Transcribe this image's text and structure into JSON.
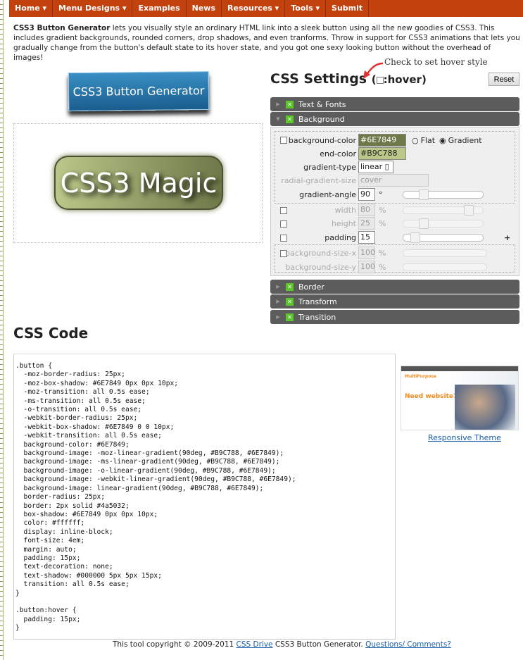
{
  "nav": [
    {
      "label": "Home",
      "dropdown": true
    },
    {
      "label": "Menu Designs",
      "dropdown": true
    },
    {
      "label": "Examples",
      "dropdown": false
    },
    {
      "label": "News",
      "dropdown": false
    },
    {
      "label": "Resources",
      "dropdown": true
    },
    {
      "label": "Tools",
      "dropdown": true
    },
    {
      "label": "Submit",
      "dropdown": false
    }
  ],
  "intro": {
    "bold": "CSS3 Button Generator",
    "text": " lets you visually style an ordinary HTML link into a sleek button using all the new goodies of CSS3. This includes gradient backgrounds, rounded corners, drop shadows, and even tranforms. Throw in support for CSS3 animations that lets you gradually change from the button's default state to its hover state, and you got one sexy looking button without the overhead of images!"
  },
  "logo": "CSS3 Button Generator",
  "preview_button": "CSS3 Magic",
  "settings": {
    "title": "CSS Settings",
    "paren_open": "(",
    "hover_label": ":hover)",
    "hover_note": "Check to set hover style",
    "reset": "Reset",
    "panels": {
      "text": "Text & Fonts",
      "background": "Background",
      "border": "Border",
      "transform": "Transform",
      "transition": "Transition"
    },
    "bg": {
      "bgcolor_label": "background-color",
      "bgcolor": "#6E7849",
      "flat": "Flat",
      "gradient": "Gradient",
      "endcolor_label": "end-color",
      "endcolor": "#B9C788",
      "gtype_label": "gradient-type",
      "gtype": "linear",
      "rsize_label": "radial-gradient-size",
      "rsize": "cover",
      "angle_label": "gradient-angle",
      "angle": "90",
      "deg": "°",
      "width_label": "width",
      "width": "80",
      "height_label": "height",
      "height": "25",
      "pct": "%",
      "padding_label": "padding",
      "padding": "15",
      "plus": "+",
      "bsx_label": "background-size-x",
      "bsx": "100",
      "bsy_label": "background-size-y",
      "bsy": "100"
    }
  },
  "code_title": "CSS Code",
  "code": [
    ".button {",
    "  -moz-border-radius: 25px;",
    "  -moz-box-shadow: #6E7849 0px 0px 10px;",
    "  -moz-transition: all 0.5s ease;",
    "  -ms-transition: all 0.5s ease;",
    "  -o-transition: all 0.5s ease;",
    "  -webkit-border-radius: 25px;",
    "  -webkit-box-shadow: #6E7849 0 0 10px;",
    "  -webkit-transition: all 0.5s ease;",
    "  background-color: #6E7849;",
    "  background-image: -moz-linear-gradient(90deg, #B9C788, #6E7849);",
    "  background-image: -ms-linear-gradient(90deg, #B9C788, #6E7849);",
    "  background-image: -o-linear-gradient(90deg, #B9C788, #6E7849);",
    "  background-image: -webkit-linear-gradient(90deg, #B9C788, #6E7849);",
    "  background-image: linear-gradient(90deg, #B9C788, #6E7849);",
    "  border-radius: 25px;",
    "  border: 2px solid #4a5032;",
    "  box-shadow: #6E7849 0px 0px 10px;",
    "  color: #ffffff;",
    "  display: inline-block;",
    "  font-size: 4em;",
    "  margin: auto;",
    "  padding: 15px;",
    "  text-decoration: none;",
    "  text-shadow: #000000 5px 5px 15px;",
    "  transition: all 0.5s ease;",
    "}",
    "",
    ".button:hover {",
    "  padding: 15px;",
    "}"
  ],
  "ad": {
    "headline": "Need website?",
    "brand": "MultiPurpose",
    "link": "Responsive Theme"
  },
  "footer": {
    "pre": "This tool copyright © 2009-2011 ",
    "link1": "CSS Drive",
    "mid": " CSS3 Button Generator. ",
    "link2": "Questions/ Comments?"
  }
}
